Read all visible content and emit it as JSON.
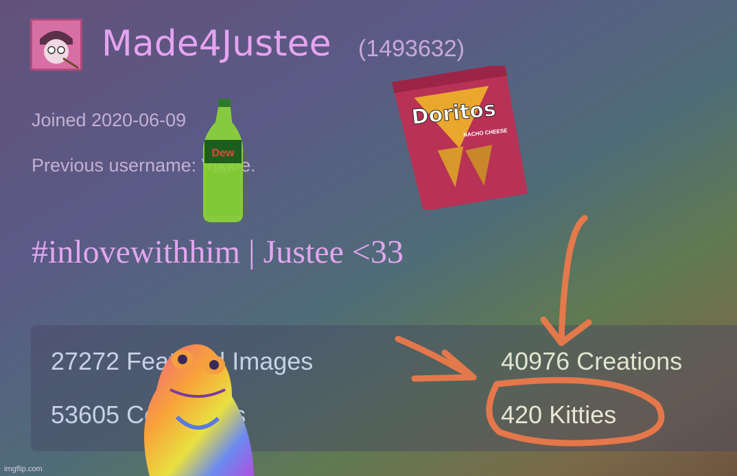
{
  "profile": {
    "username": "Made4Justee",
    "user_id": "(1493632)",
    "joined": "Joined 2020-06-09",
    "previous_username": "Previous username: Vikkie.",
    "bio": "#inlovewithhim | Justee <33"
  },
  "stats": {
    "featured": "27272 Featured Images",
    "creations": "40976 Creations",
    "comments": "53605 Comments",
    "kitties": "420 Kitties"
  },
  "stickers": {
    "chips_brand": "Doritos",
    "chips_flavor": "NACHO CHEESE",
    "soda_brand": "Dew"
  },
  "watermark": "imgflip.com",
  "colors": {
    "username": "#e6a3f0",
    "annotation": "#f07a4a"
  }
}
